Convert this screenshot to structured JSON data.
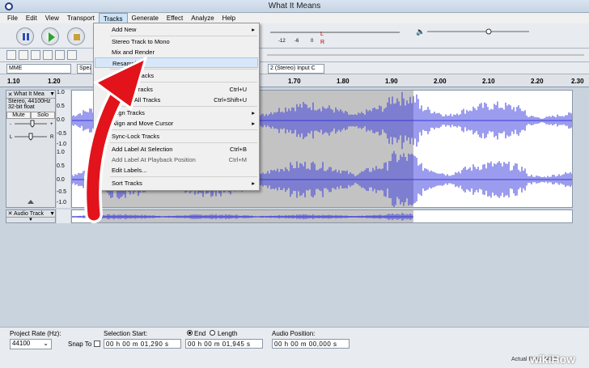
{
  "window": {
    "title": "What It Means"
  },
  "menubar": [
    "File",
    "Edit",
    "View",
    "Transport",
    "Tracks",
    "Generate",
    "Effect",
    "Analyze",
    "Help"
  ],
  "meter": {
    "ticks": [
      "-42",
      "-36",
      "-30",
      "-24",
      "-18",
      "-12",
      "-6",
      "0"
    ],
    "right_ticks": [
      "-42",
      "-36",
      "-30",
      "-24",
      "-18",
      "-12",
      "-6",
      "0"
    ],
    "l": "L",
    "r": "R"
  },
  "device": {
    "host": "MME",
    "playback": "Spea",
    "input": "2 (Stereo) Input C"
  },
  "ruler": {
    "ticks": [
      "1.10",
      "1.20",
      "1.70",
      "1.80",
      "1.90",
      "2.00",
      "2.10",
      "2.20",
      "2.30"
    ]
  },
  "track1": {
    "name": "What It Mea",
    "info1": "Stereo, 44100Hz",
    "info2": "32-bit float",
    "mute": "Mute",
    "solo": "Solo",
    "scale": [
      "1.0",
      "0.5",
      "0.0",
      "-0.5",
      "-1.0",
      "1.0",
      "0.5",
      "0.0",
      "-0.5",
      "-1.0"
    ],
    "l": "L",
    "r": "R"
  },
  "track2": {
    "name": "Audio Track"
  },
  "tracks_menu": {
    "items": [
      {
        "label": "Add New",
        "shortcut": "",
        "submenu": true
      },
      {
        "label": "Stereo Track to Mono",
        "shortcut": "",
        "submenu": false
      },
      {
        "label": "Mix and Render",
        "shortcut": "",
        "submenu": false
      },
      {
        "label": "Resample...",
        "shortcut": "",
        "submenu": false
      },
      {
        "label": "Remove Tracks",
        "shortcut": "",
        "submenu": false
      },
      {
        "label": "Mute All Tracks",
        "shortcut": "Ctrl+U",
        "submenu": false
      },
      {
        "label": "Unmute All Tracks",
        "shortcut": "Ctrl+Shift+U",
        "submenu": false
      },
      {
        "label": "Align Tracks",
        "shortcut": "",
        "submenu": true
      },
      {
        "label": "Align and Move Cursor",
        "shortcut": "",
        "submenu": true
      },
      {
        "label": "Sync-Lock Tracks",
        "shortcut": "",
        "submenu": false
      },
      {
        "label": "Add Label At Selection",
        "shortcut": "Ctrl+B",
        "submenu": false
      },
      {
        "label": "Add Label At Playback Position",
        "shortcut": "Ctrl+M",
        "submenu": false
      },
      {
        "label": "Edit Labels...",
        "shortcut": "",
        "submenu": false
      },
      {
        "label": "Sort Tracks",
        "shortcut": "",
        "submenu": true
      }
    ]
  },
  "bottom": {
    "project_rate_label": "Project Rate (Hz):",
    "project_rate": "44100",
    "snap_label": "Snap To",
    "selection_start_label": "Selection Start:",
    "end_label": "End",
    "length_label": "Length",
    "audio_position_label": "Audio Position:",
    "start_value": "00 h 00 m 01,290 s",
    "end_value": "00 h 00 m 01,945 s",
    "position_value": "00 h 00 m 00,000 s",
    "status": "Actual Rate: 44100"
  },
  "watermark": "wikiHow",
  "colors": {
    "waveform": "#3a3adc",
    "selection": "#c3c3c3",
    "arrow": "#e2131b",
    "menu_highlight": "#d7e7f7"
  }
}
